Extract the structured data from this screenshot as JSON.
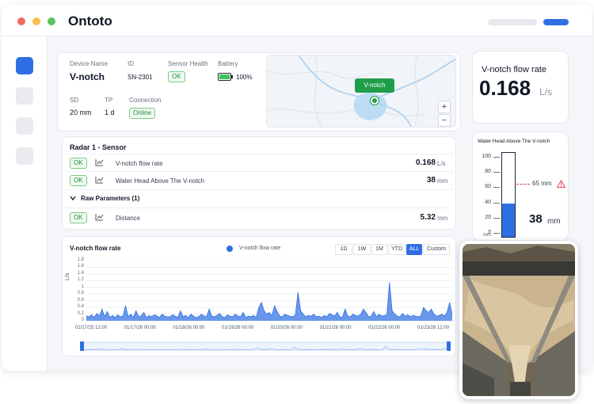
{
  "app": {
    "title": "Ontoto"
  },
  "device": {
    "name_label": "Device Name",
    "name": "V-notch",
    "id_label": "ID",
    "id": "SN-2301",
    "health_label": "Sensor Health",
    "health": "OK",
    "battery_label": "Battery",
    "battery": "100%",
    "battery_level": 1.0,
    "sd_label": "SD",
    "sd": "20 mm",
    "tp_label": "TP",
    "tp": "1 d",
    "connection_label": "Connection",
    "connection": "Online"
  },
  "map": {
    "marker_label": "V-notch",
    "zoom_in": "+",
    "zoom_out": "−"
  },
  "flow_card": {
    "title": "V-notch flow rate",
    "value": "0.168",
    "unit": "L/s"
  },
  "radar": {
    "title": "Radar 1 - Sensor",
    "rows": [
      {
        "status": "OK",
        "name": "V-notch flow rate",
        "value": "0.168",
        "unit": "L/s"
      },
      {
        "status": "OK",
        "name": "Water Head Above The V-notch",
        "value": "38",
        "unit": "mm"
      }
    ],
    "raw_title": "Raw Parameters (1)",
    "raw_rows": [
      {
        "status": "OK",
        "name": "Distance",
        "value": "5.32",
        "unit": "mm"
      }
    ]
  },
  "gauge": {
    "title": "Water Head Above The V-notch",
    "ticks": [
      "100",
      "80",
      "60",
      "40",
      "20",
      "0"
    ],
    "unit_label": "mm",
    "threshold_label": "65 mm",
    "threshold": 65,
    "level": 38,
    "value": "38",
    "value_unit": "mm",
    "max": 100
  },
  "chart_panel": {
    "title": "V-notch flow rate",
    "legend": "V-notch flow rate",
    "ranges": [
      "1D",
      "1W",
      "1M",
      "YTD",
      "ALL",
      "Custom"
    ],
    "active_range": "ALL"
  },
  "chart_data": {
    "type": "area",
    "ylabel": "L/s",
    "ylim": [
      0,
      1.8
    ],
    "yticks": [
      "1.8",
      "1.6",
      "1.4",
      "1.2",
      "1",
      "0.8",
      "0.6",
      "0.4",
      "0.2",
      "0"
    ],
    "xticks": [
      "01/17/25 12:00",
      "01/17/26 00:00",
      "01/18/26 00:00",
      "01/19/26 00:00",
      "01/20/26 00:00",
      "01/21/26 00:00",
      "01/22/26 00:00",
      "01/23/26 12:00"
    ],
    "series": [
      {
        "name": "V-notch flow rate",
        "x": [
          0,
          0.05,
          0.1,
          0.15,
          0.2,
          0.25,
          0.3,
          0.35,
          0.4,
          0.45,
          0.5,
          0.55,
          0.6,
          0.65,
          0.7,
          0.75,
          0.8,
          0.85,
          0.9,
          0.95,
          1,
          1.05,
          1.1,
          1.15,
          1.2,
          1.25,
          1.3,
          1.35,
          1.4,
          1.45,
          1.5,
          1.55,
          1.6,
          1.65,
          1.7,
          1.75,
          1.8,
          1.85,
          1.9,
          1.95,
          2,
          2.05,
          2.1,
          2.15,
          2.2,
          2.25,
          2.3,
          2.35,
          2.4,
          2.45,
          2.5,
          2.55,
          2.6,
          2.65,
          2.7,
          2.75,
          2.8,
          2.85,
          2.9,
          2.95,
          3,
          3.05,
          3.1,
          3.15,
          3.2,
          3.25,
          3.3,
          3.35,
          3.4,
          3.45,
          3.5,
          3.55,
          3.6,
          3.65,
          3.7,
          3.75,
          3.8,
          3.85,
          3.9,
          3.95,
          4,
          4.05,
          4.1,
          4.15,
          4.2,
          4.25,
          4.3,
          4.35,
          4.4,
          4.45,
          4.5,
          4.55,
          4.6,
          4.65,
          4.7,
          4.75,
          4.8,
          4.85,
          4.9,
          4.95,
          5,
          5.05,
          5.1,
          5.15,
          5.2,
          5.25,
          5.3,
          5.35,
          5.4,
          5.45,
          5.5,
          5.55,
          5.6,
          5.65,
          5.7,
          5.75,
          5.8,
          5.85,
          5.9,
          5.95,
          6,
          6.05,
          6.1,
          6.15,
          6.2,
          6.25,
          6.3,
          6.35,
          6.4,
          6.45,
          6.5,
          6.55,
          6.6,
          6.65,
          6.7,
          6.75,
          6.8,
          6.85,
          6.9,
          6.95,
          7
        ],
        "y": [
          0.15,
          0.12,
          0.18,
          0.1,
          0.22,
          0.14,
          0.35,
          0.12,
          0.28,
          0.1,
          0.16,
          0.1,
          0.18,
          0.12,
          0.14,
          0.45,
          0.12,
          0.2,
          0.1,
          0.3,
          0.12,
          0.15,
          0.25,
          0.1,
          0.16,
          0.12,
          0.18,
          0.15,
          0.1,
          0.2,
          0.14,
          0.12,
          0.12,
          0.18,
          0.14,
          0.1,
          0.3,
          0.12,
          0.16,
          0.1,
          0.2,
          0.14,
          0.1,
          0.12,
          0.2,
          0.15,
          0.12,
          0.35,
          0.14,
          0.12,
          0.16,
          0.22,
          0.12,
          0.1,
          0.18,
          0.14,
          0.12,
          0.2,
          0.15,
          0.12,
          0.25,
          0.1,
          0.14,
          0.12,
          0.16,
          0.1,
          0.4,
          0.55,
          0.3,
          0.2,
          0.25,
          0.15,
          0.45,
          0.28,
          0.14,
          0.12,
          0.2,
          0.16,
          0.14,
          0.12,
          0.18,
          0.85,
          0.3,
          0.2,
          0.12,
          0.16,
          0.14,
          0.2,
          0.12,
          0.14,
          0.1,
          0.16,
          0.12,
          0.22,
          0.18,
          0.14,
          0.25,
          0.12,
          0.1,
          0.35,
          0.14,
          0.12,
          0.2,
          0.16,
          0.14,
          0.2,
          0.35,
          0.25,
          0.12,
          0.14,
          0.28,
          0.12,
          0.2,
          0.14,
          0.16,
          0.18,
          1.15,
          0.3,
          0.2,
          0.14,
          0.12,
          0.22,
          0.14,
          0.18,
          0.12,
          0.16,
          0.14,
          0.12,
          0.15,
          0.4,
          0.3,
          0.25,
          0.35,
          0.2,
          0.14,
          0.16,
          0.2,
          0.14,
          0.25,
          0.55,
          0.18
        ]
      }
    ],
    "grid": true
  },
  "colors": {
    "accent": "#2f6fe4",
    "area": "#4f86e8",
    "ok": "#1f8a3a",
    "warning": "#e0434b",
    "map_water": "#bcdcf4"
  }
}
